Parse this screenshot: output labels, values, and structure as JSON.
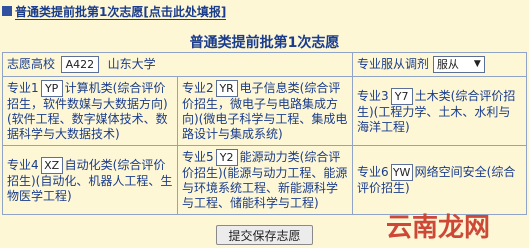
{
  "top_link": {
    "prefix": "普通类提前批第1次志愿",
    "link": "[点击此处填报]"
  },
  "title": "普通类提前批第1次志愿",
  "school": {
    "label": "志愿高校",
    "code": "A422",
    "name": "山东大学"
  },
  "adjust": {
    "label": "专业服从调剂",
    "selected": "服从"
  },
  "majors": [
    {
      "label": "专业1",
      "code": "YP",
      "text": "计算机类(综合评价招生，软件数媒与大数据方向)(软件工程、数字媒体技术、数据科学与大数据技术)"
    },
    {
      "label": "专业2",
      "code": "YR",
      "text": "电子信息类(综合评价招生，微电子与电路集成方向)(微电子科学与工程、集成电路设计与集成系统)"
    },
    {
      "label": "专业3",
      "code": "Y7",
      "text": "土木类(综合评价招生)(工程力学、土木、水利与海洋工程)"
    },
    {
      "label": "专业4",
      "code": "XZ",
      "text": "自动化类(综合评价招生)(自动化、机器人工程、生物医学工程)"
    },
    {
      "label": "专业5",
      "code": "Y2",
      "text": "能源动力类(综合评价招生)(能源与动力工程、能源与环境系统工程、新能源科学与工程、储能科学与工程)"
    },
    {
      "label": "专业6",
      "code": "YW",
      "text": "网络空间安全(综合评价招生)"
    }
  ],
  "submit_label": "提交保存志愿",
  "watermark": "云南龙网"
}
